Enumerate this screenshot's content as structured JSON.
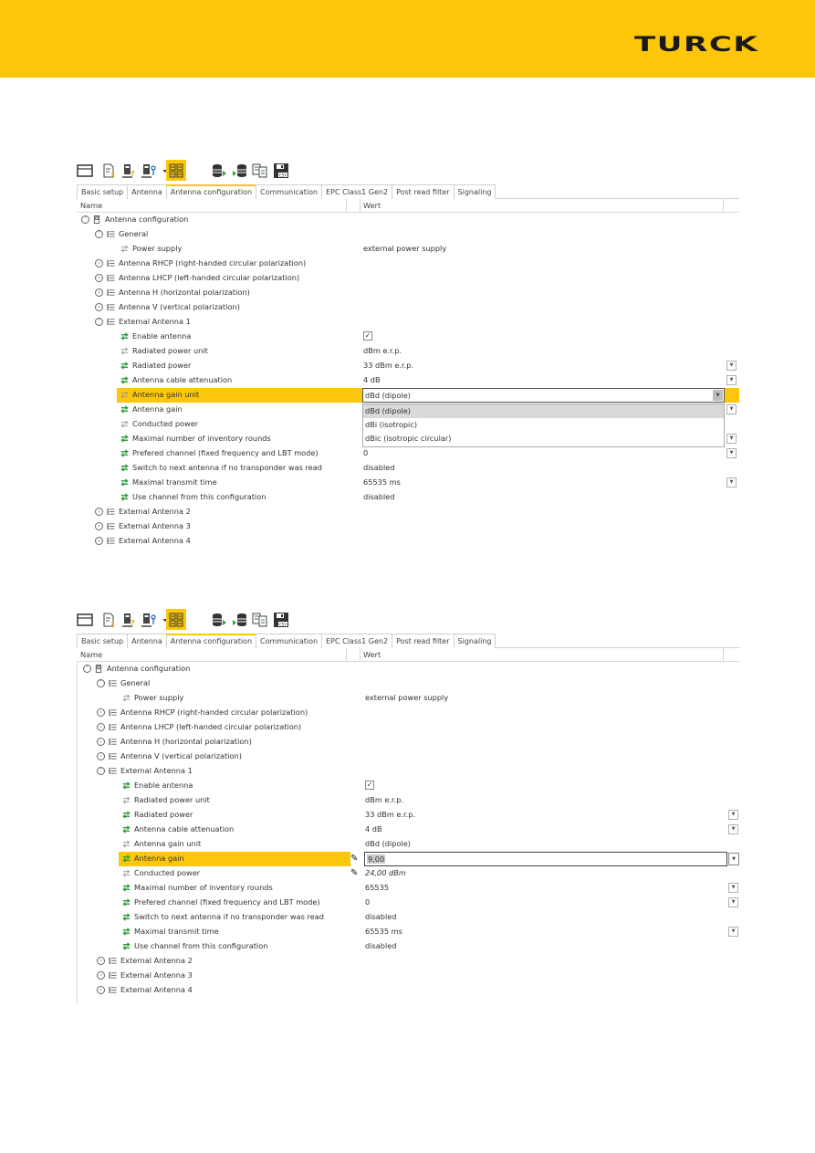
{
  "brand": {
    "logo_text": "TURCK",
    "accent": "#fcc70a"
  },
  "tabs": [
    "Basic setup",
    "Antenna",
    "Antenna configuration",
    "Communication",
    "EPC Class1 Gen2",
    "Post read filter",
    "Signaling"
  ],
  "active_tab": "Antenna configuration",
  "columns": {
    "name": "Name",
    "value": "Wert"
  },
  "toolbar_icons": [
    "window-icon",
    "document-help-icon",
    "device-help-icon",
    "device-key-icon",
    "dropdown-arrow-icon",
    "grid-view-icon",
    "database-export-icon",
    "database-import-icon",
    "compare-icon",
    "save-csv-icon"
  ],
  "tree": {
    "root": "Antenna configuration",
    "general": "General",
    "power_supply": {
      "label": "Power supply",
      "value": "external power supply"
    },
    "groups": [
      "Antenna RHCP (right-handed circular polarization)",
      "Antenna LHCP (left-handed circular polarization)",
      "Antenna H (horizontal polarization)",
      "Antenna V (vertical polarization)"
    ],
    "ext1": "External Antenna 1",
    "ext_more": [
      "External Antenna 2",
      "External Antenna 3",
      "External Antenna 4"
    ]
  },
  "screen1": {
    "params": [
      {
        "label": "Enable antenna",
        "value": "",
        "checked": true
      },
      {
        "label": "Radiated power unit",
        "value": "dBm e.r.p."
      },
      {
        "label": "Radiated power",
        "value": "33 dBm e.r.p."
      },
      {
        "label": "Antenna cable attenuation",
        "value": "4 dB"
      },
      {
        "label": "Antenna gain unit",
        "value": "dBd (dipole)"
      },
      {
        "label": "Antenna gain",
        "value": ""
      },
      {
        "label": "Conducted power",
        "value": ""
      },
      {
        "label": "Maximal number of inventory rounds",
        "value": ""
      },
      {
        "label": "Prefered channel  (fixed frequency and LBT mode)",
        "value": "0"
      },
      {
        "label": "Switch to next antenna if no transponder was read",
        "value": "disabled"
      },
      {
        "label": "Maximal transmit time",
        "value": "65535 ms"
      },
      {
        "label": "Use channel from this configuration",
        "value": "disabled"
      }
    ],
    "dropdown_options": [
      "dBd (dipole)",
      "dBi (isotropic)",
      "dBic (isotropic circular)"
    ],
    "dropdown_selected": "dBd (dipole)"
  },
  "screen2": {
    "params": [
      {
        "label": "Enable antenna",
        "value": "",
        "checked": true
      },
      {
        "label": "Radiated power unit",
        "value": "dBm e.r.p."
      },
      {
        "label": "Radiated power",
        "value": "33 dBm e.r.p."
      },
      {
        "label": "Antenna cable attenuation",
        "value": "4 dB"
      },
      {
        "label": "Antenna gain unit",
        "value": "dBd (dipole)"
      },
      {
        "label": "Antenna gain",
        "value": "9,00"
      },
      {
        "label": "Conducted power",
        "value": "24,00 dBm"
      },
      {
        "label": "Maximal number of inventory rounds",
        "value": "65535"
      },
      {
        "label": "Prefered channel  (fixed frequency and LBT mode)",
        "value": "0"
      },
      {
        "label": "Switch to next antenna if no transponder was read",
        "value": "disabled"
      },
      {
        "label": "Maximal transmit time",
        "value": "65535 ms"
      },
      {
        "label": "Use channel from this configuration",
        "value": "disabled"
      }
    ]
  }
}
